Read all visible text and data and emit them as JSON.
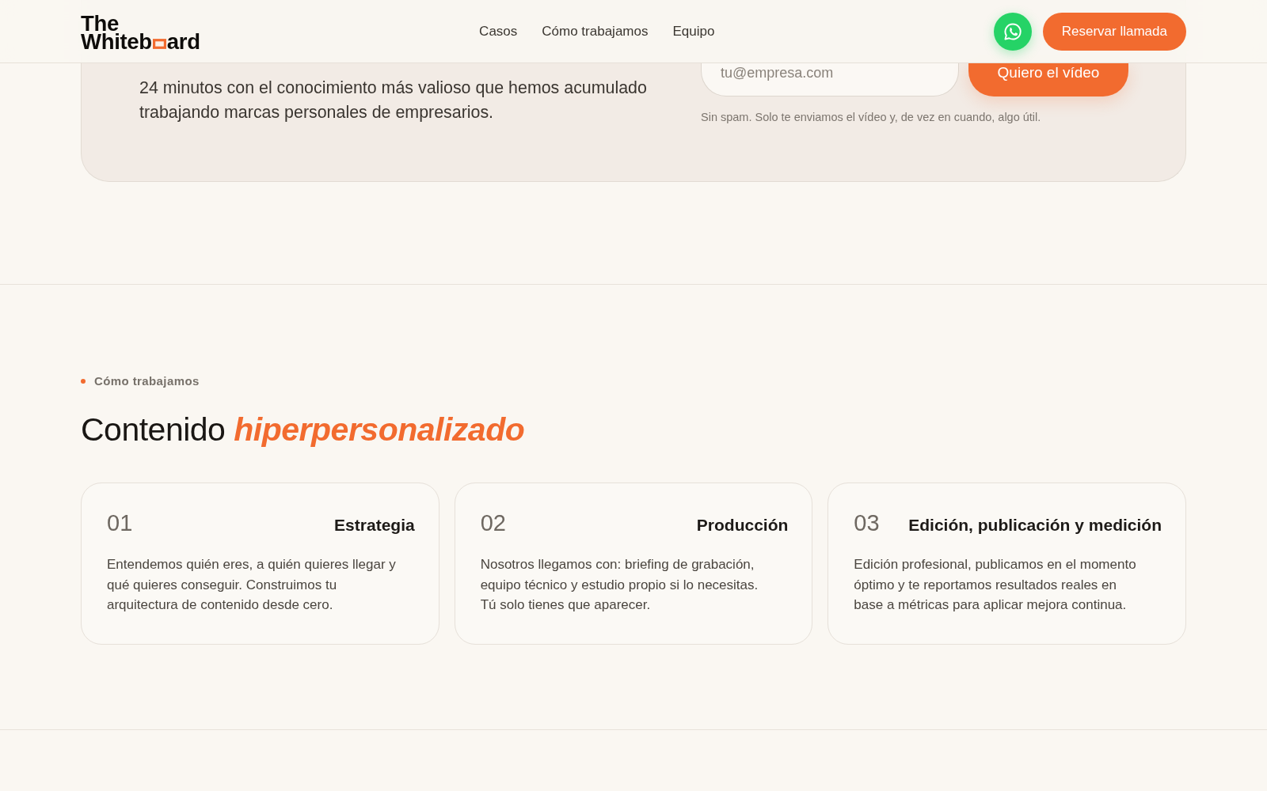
{
  "header": {
    "logo": {
      "line_1": "The",
      "line_2": [
        "Whiteb",
        "ard"
      ]
    },
    "nav": [
      {
        "label": "Casos"
      },
      {
        "label": "Cómo trabajamos"
      },
      {
        "label": "Equipo"
      }
    ],
    "cta": "Reservar llamada"
  },
  "video_offer": {
    "description": "24 minutos con el conocimiento más valioso que hemos acumulado trabajando marcas personales de empresarios.",
    "email": {
      "placeholder": "tu@empresa.com"
    },
    "submit": "Quiero el vídeo",
    "note": "Sin spam. Solo te enviamos el vídeo y, de vez en cuando, algo útil."
  },
  "process": {
    "eyebrow": "Cómo trabajamos",
    "title": "Contenido *hiperpersonalizado*",
    "steps": [
      {
        "number": "01",
        "title": "Estrategia",
        "text": "Entendemos quién eres, a quién quieres llegar y qué quieres conseguir. Construimos tu arquitectura de contenido desde cero."
      },
      {
        "number": "02",
        "title": "Producción",
        "text": "Nosotros llegamos con: briefing de grabación, equipo técnico y estudio propio si lo necesitas. Tú solo tienes que aparecer."
      },
      {
        "number": "03",
        "title": "Edición, publicación y medición",
        "text": "Edición profesional, publicamos en el momento óptimo y te reportamos resultados reales en base a métricas para aplicar mejora continua."
      }
    ]
  }
}
